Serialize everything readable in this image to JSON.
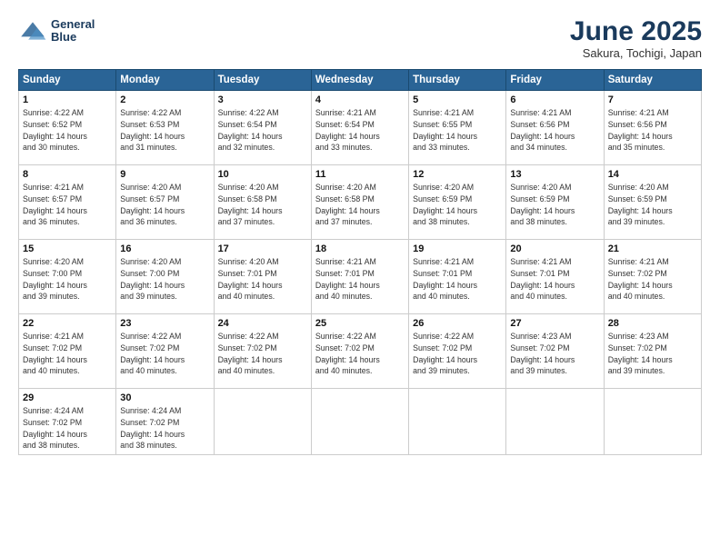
{
  "logo": {
    "line1": "General",
    "line2": "Blue"
  },
  "title": "June 2025",
  "subtitle": "Sakura, Tochigi, Japan",
  "days_of_week": [
    "Sunday",
    "Monday",
    "Tuesday",
    "Wednesday",
    "Thursday",
    "Friday",
    "Saturday"
  ],
  "weeks": [
    [
      {
        "day": 1,
        "info": "Sunrise: 4:22 AM\nSunset: 6:52 PM\nDaylight: 14 hours\nand 30 minutes."
      },
      {
        "day": 2,
        "info": "Sunrise: 4:22 AM\nSunset: 6:53 PM\nDaylight: 14 hours\nand 31 minutes."
      },
      {
        "day": 3,
        "info": "Sunrise: 4:22 AM\nSunset: 6:54 PM\nDaylight: 14 hours\nand 32 minutes."
      },
      {
        "day": 4,
        "info": "Sunrise: 4:21 AM\nSunset: 6:54 PM\nDaylight: 14 hours\nand 33 minutes."
      },
      {
        "day": 5,
        "info": "Sunrise: 4:21 AM\nSunset: 6:55 PM\nDaylight: 14 hours\nand 33 minutes."
      },
      {
        "day": 6,
        "info": "Sunrise: 4:21 AM\nSunset: 6:56 PM\nDaylight: 14 hours\nand 34 minutes."
      },
      {
        "day": 7,
        "info": "Sunrise: 4:21 AM\nSunset: 6:56 PM\nDaylight: 14 hours\nand 35 minutes."
      }
    ],
    [
      {
        "day": 8,
        "info": "Sunrise: 4:21 AM\nSunset: 6:57 PM\nDaylight: 14 hours\nand 36 minutes."
      },
      {
        "day": 9,
        "info": "Sunrise: 4:20 AM\nSunset: 6:57 PM\nDaylight: 14 hours\nand 36 minutes."
      },
      {
        "day": 10,
        "info": "Sunrise: 4:20 AM\nSunset: 6:58 PM\nDaylight: 14 hours\nand 37 minutes."
      },
      {
        "day": 11,
        "info": "Sunrise: 4:20 AM\nSunset: 6:58 PM\nDaylight: 14 hours\nand 37 minutes."
      },
      {
        "day": 12,
        "info": "Sunrise: 4:20 AM\nSunset: 6:59 PM\nDaylight: 14 hours\nand 38 minutes."
      },
      {
        "day": 13,
        "info": "Sunrise: 4:20 AM\nSunset: 6:59 PM\nDaylight: 14 hours\nand 38 minutes."
      },
      {
        "day": 14,
        "info": "Sunrise: 4:20 AM\nSunset: 6:59 PM\nDaylight: 14 hours\nand 39 minutes."
      }
    ],
    [
      {
        "day": 15,
        "info": "Sunrise: 4:20 AM\nSunset: 7:00 PM\nDaylight: 14 hours\nand 39 minutes."
      },
      {
        "day": 16,
        "info": "Sunrise: 4:20 AM\nSunset: 7:00 PM\nDaylight: 14 hours\nand 39 minutes."
      },
      {
        "day": 17,
        "info": "Sunrise: 4:20 AM\nSunset: 7:01 PM\nDaylight: 14 hours\nand 40 minutes."
      },
      {
        "day": 18,
        "info": "Sunrise: 4:21 AM\nSunset: 7:01 PM\nDaylight: 14 hours\nand 40 minutes."
      },
      {
        "day": 19,
        "info": "Sunrise: 4:21 AM\nSunset: 7:01 PM\nDaylight: 14 hours\nand 40 minutes."
      },
      {
        "day": 20,
        "info": "Sunrise: 4:21 AM\nSunset: 7:01 PM\nDaylight: 14 hours\nand 40 minutes."
      },
      {
        "day": 21,
        "info": "Sunrise: 4:21 AM\nSunset: 7:02 PM\nDaylight: 14 hours\nand 40 minutes."
      }
    ],
    [
      {
        "day": 22,
        "info": "Sunrise: 4:21 AM\nSunset: 7:02 PM\nDaylight: 14 hours\nand 40 minutes."
      },
      {
        "day": 23,
        "info": "Sunrise: 4:22 AM\nSunset: 7:02 PM\nDaylight: 14 hours\nand 40 minutes."
      },
      {
        "day": 24,
        "info": "Sunrise: 4:22 AM\nSunset: 7:02 PM\nDaylight: 14 hours\nand 40 minutes."
      },
      {
        "day": 25,
        "info": "Sunrise: 4:22 AM\nSunset: 7:02 PM\nDaylight: 14 hours\nand 40 minutes."
      },
      {
        "day": 26,
        "info": "Sunrise: 4:22 AM\nSunset: 7:02 PM\nDaylight: 14 hours\nand 39 minutes."
      },
      {
        "day": 27,
        "info": "Sunrise: 4:23 AM\nSunset: 7:02 PM\nDaylight: 14 hours\nand 39 minutes."
      },
      {
        "day": 28,
        "info": "Sunrise: 4:23 AM\nSunset: 7:02 PM\nDaylight: 14 hours\nand 39 minutes."
      }
    ],
    [
      {
        "day": 29,
        "info": "Sunrise: 4:24 AM\nSunset: 7:02 PM\nDaylight: 14 hours\nand 38 minutes."
      },
      {
        "day": 30,
        "info": "Sunrise: 4:24 AM\nSunset: 7:02 PM\nDaylight: 14 hours\nand 38 minutes."
      },
      null,
      null,
      null,
      null,
      null
    ]
  ]
}
